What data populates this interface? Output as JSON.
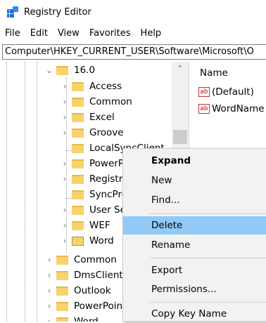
{
  "window": {
    "title": "Registry Editor"
  },
  "menu": [
    "File",
    "Edit",
    "View",
    "Favorites",
    "Help"
  ],
  "address": "Computer\\HKEY_CURRENT_USER\\Software\\Microsoft\\O",
  "tree": {
    "parent": "16.0",
    "children": [
      "Access",
      "Common",
      "Excel",
      "Groove",
      "LocalSyncClient",
      "PowerPoint",
      "Registration",
      "SyncProviders",
      "User Settings",
      "WEF",
      "Word"
    ],
    "siblings": [
      "Common",
      "DmsClient",
      "Outlook",
      "PowerPoint",
      "Word"
    ]
  },
  "values_pane": {
    "column_name": "Name",
    "values": [
      {
        "icon": "string-value-icon",
        "name": "(Default)"
      },
      {
        "icon": "string-value-icon",
        "name": "WordName"
      }
    ]
  },
  "context_menu": {
    "items": [
      "Expand",
      "New",
      "Find...",
      "Delete",
      "Rename",
      "Export",
      "Permissions...",
      "Copy Key Name"
    ],
    "highlighted": "Delete"
  },
  "colors": {
    "folder": "#f9d26b",
    "menu_highlight": "#91c9f7",
    "menu_bg": "#f2f2f2"
  }
}
